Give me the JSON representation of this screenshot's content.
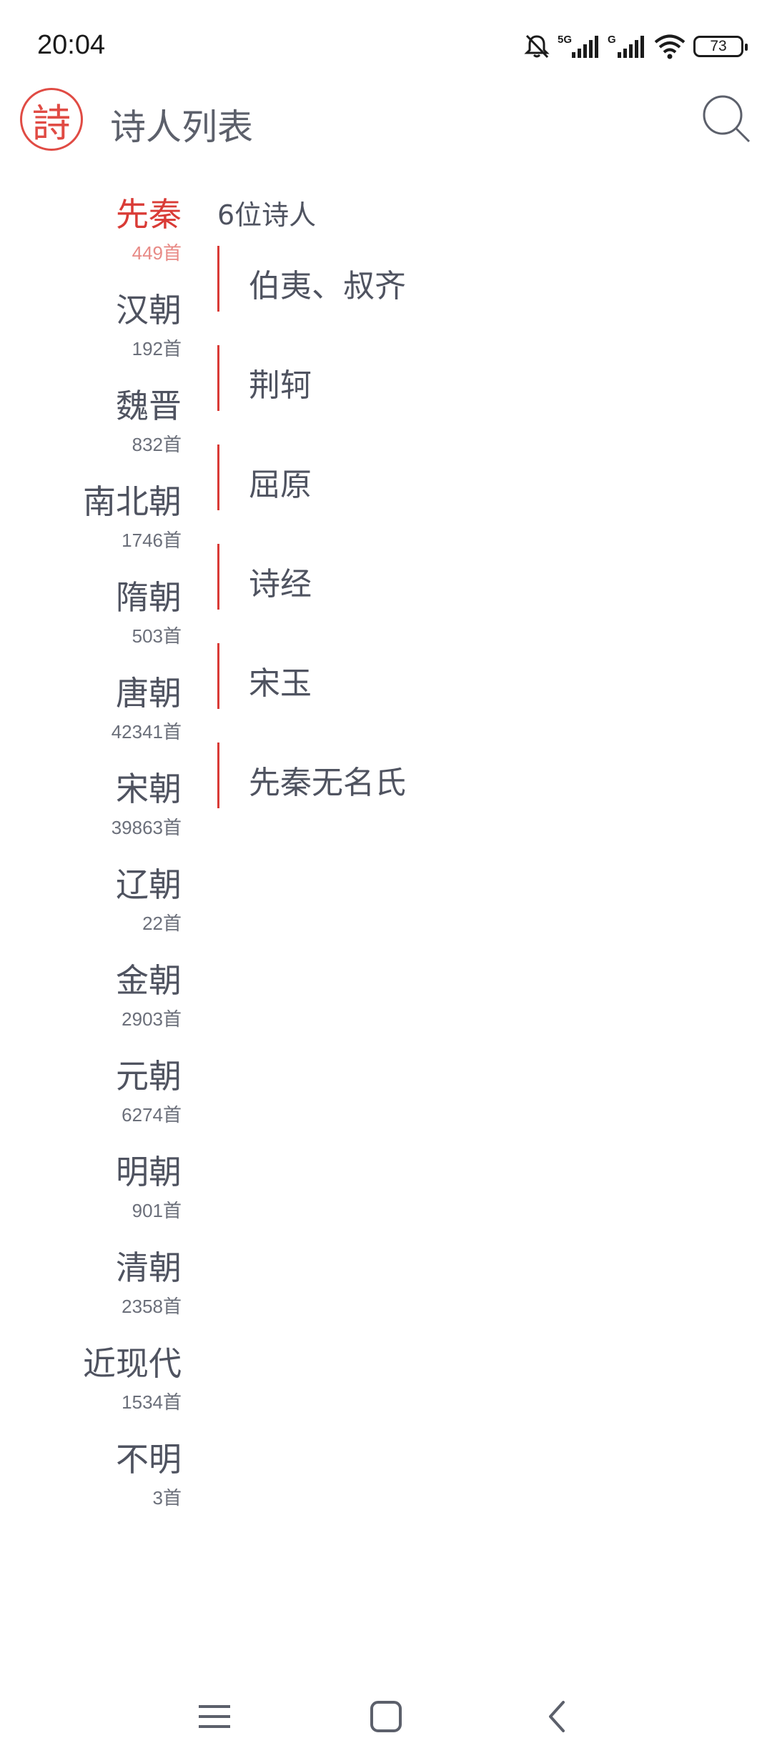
{
  "status_bar": {
    "time": "20:04",
    "icons": [
      "silent-bell-icon",
      "signal-5g-icon",
      "signal-g-icon",
      "wifi-icon"
    ],
    "battery": "73"
  },
  "header": {
    "logo_text": "詩",
    "title": "诗人列表",
    "search_icon": "search-icon",
    "accent_color": "#d93b36"
  },
  "dynasties": [
    {
      "name": "先秦",
      "count": "449首",
      "active": true
    },
    {
      "name": "汉朝",
      "count": "192首"
    },
    {
      "name": "魏晋",
      "count": "832首"
    },
    {
      "name": "南北朝",
      "count": "1746首"
    },
    {
      "name": "隋朝",
      "count": "503首"
    },
    {
      "name": "唐朝",
      "count": "42341首"
    },
    {
      "name": "宋朝",
      "count": "39863首"
    },
    {
      "name": "辽朝",
      "count": "22首"
    },
    {
      "name": "金朝",
      "count": "2903首"
    },
    {
      "name": "元朝",
      "count": "6274首"
    },
    {
      "name": "明朝",
      "count": "901首"
    },
    {
      "name": "清朝",
      "count": "2358首"
    },
    {
      "name": "近现代",
      "count": "1534首"
    },
    {
      "name": "不明",
      "count": "3首"
    }
  ],
  "poets": {
    "count_label": "6位诗人",
    "items": [
      "伯夷、叔齐",
      "荆轲",
      "屈原",
      "诗经",
      "宋玉",
      "先秦无名氏"
    ]
  },
  "nav_bar": {
    "buttons": [
      "menu-icon",
      "home-icon",
      "back-icon"
    ]
  }
}
